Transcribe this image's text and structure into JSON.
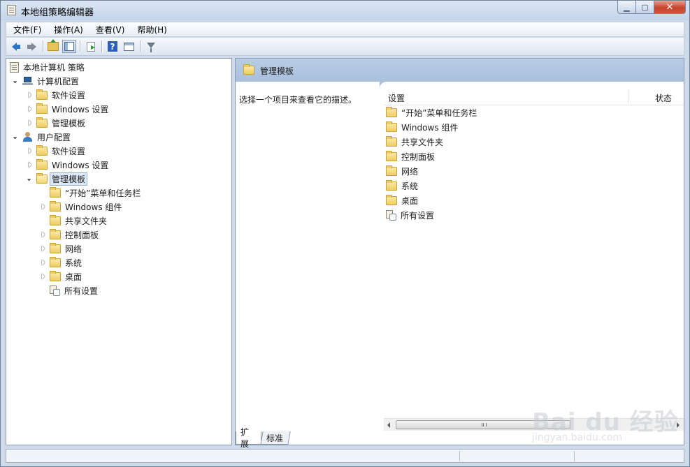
{
  "window": {
    "title": "本地组策略编辑器",
    "controls": {
      "minimize": "▁",
      "maximize": "▢",
      "close": "✕"
    }
  },
  "menubar": {
    "items": [
      "文件(F)",
      "操作(A)",
      "查看(V)",
      "帮助(H)"
    ]
  },
  "toolbar": {
    "buttons": [
      "back-arrow-icon",
      "forward-arrow-icon",
      "up-folder-icon",
      "show-hide-tree-icon",
      "export-list-icon",
      "help-icon",
      "show-hide-action-pane-icon",
      "filter-icon"
    ],
    "active": "show-hide-tree-icon"
  },
  "tree": {
    "root": "本地计算机 策略",
    "computer_config": "计算机配置",
    "cc_software": "软件设置",
    "cc_windows": "Windows 设置",
    "cc_admin": "管理模板",
    "user_config": "用户配置",
    "uc_software": "软件设置",
    "uc_windows": "Windows 设置",
    "uc_admin": "管理模板",
    "children": [
      "“开始”菜单和任务栏",
      "Windows 组件",
      "共享文件夹",
      "控制面板",
      "网络",
      "系统",
      "桌面",
      "所有设置"
    ]
  },
  "details": {
    "header_title": "管理模板",
    "description": "选择一个项目来查看它的描述。",
    "columns": {
      "setting": "设置",
      "status": "状态"
    },
    "items": [
      "“开始”菜单和任务栏",
      "Windows 组件",
      "共享文件夹",
      "控制面板",
      "网络",
      "系统",
      "桌面",
      "所有设置"
    ]
  },
  "tabs": {
    "extended": "扩展",
    "standard": "标准"
  },
  "watermark": {
    "brand": "Bai du 经验",
    "url": "jingyan.baidu.com"
  },
  "colors": {
    "header": "#a9c0dd",
    "selection": "#dde9f7",
    "folder": "#eecc63"
  }
}
